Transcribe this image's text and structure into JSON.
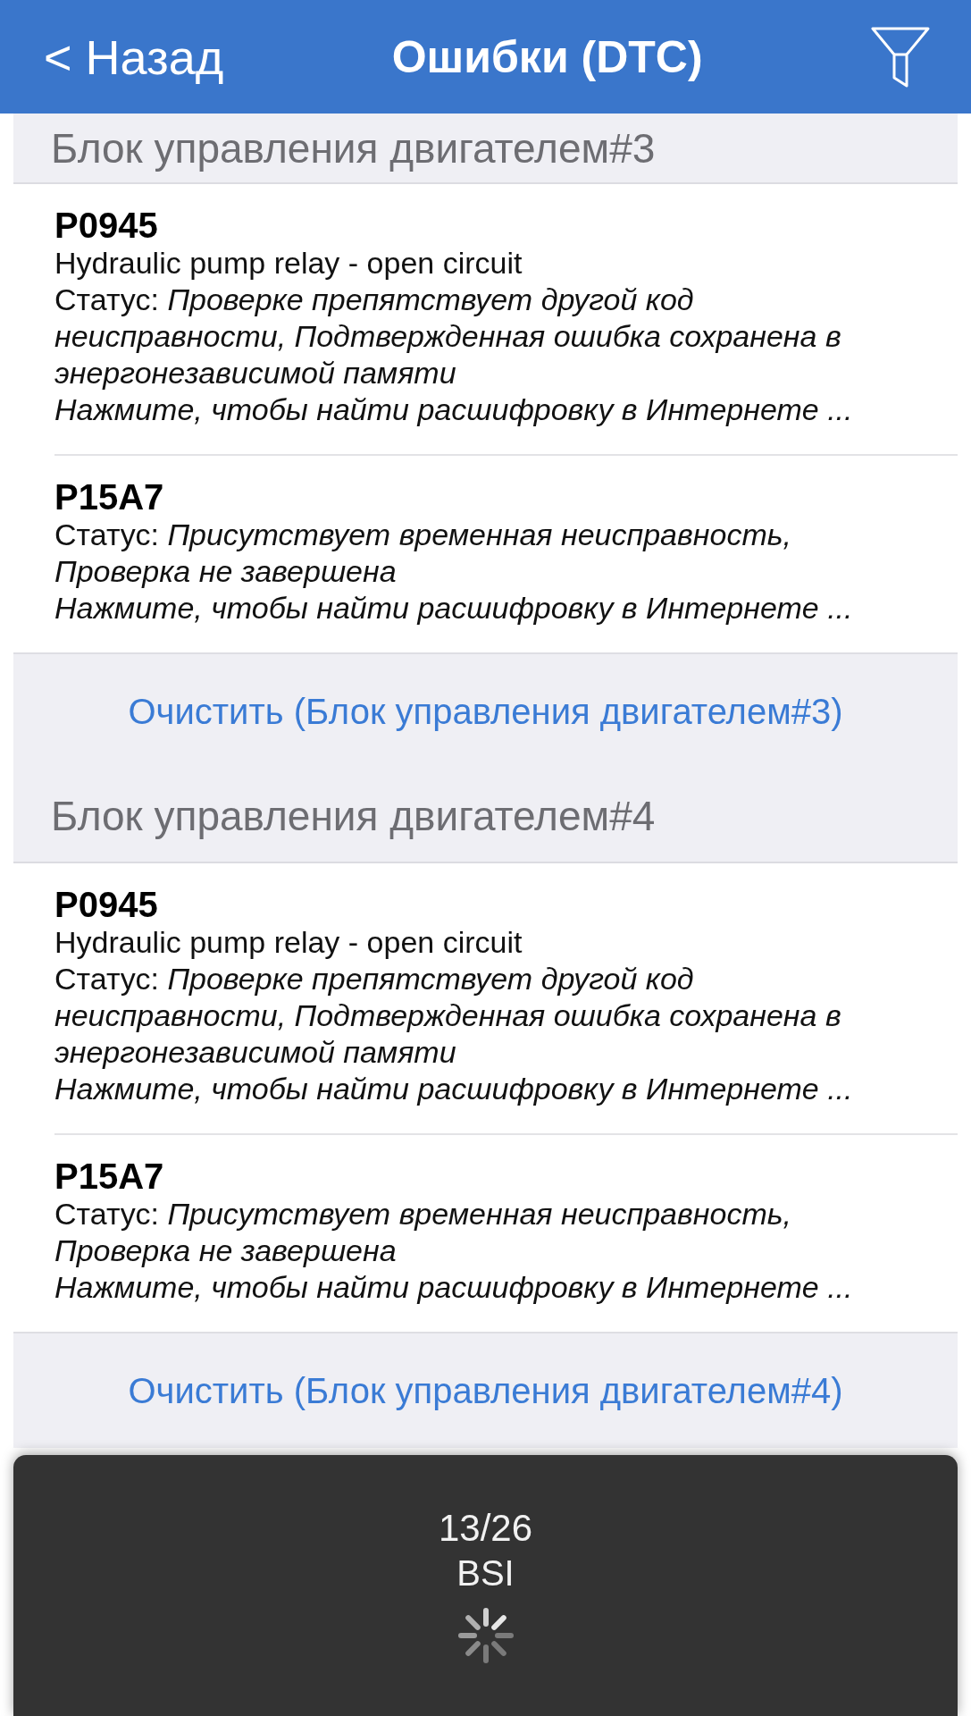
{
  "nav_bar": {
    "back_button": "< Назад",
    "title": "Ошибки (DTC)"
  },
  "sections": [
    {
      "title": "Блок управления двигателем#3",
      "errors": [
        {
          "code": "P0945",
          "description": "Hydraulic pump relay - open circuit",
          "status": "Статус: *Проверке препятствует другой код неисправности, Подтвержденная ошибка сохранена в энергонезависимой памяти*",
          "hint": "Нажмите, чтобы найти расшифровку в Интернете ..."
        },
        {
          "code": "P15A7",
          "status": "Статус: *Присутствует временная неисправность, Проверка не завершена*",
          "hint": "Нажмите, чтобы найти расшифровку в Интернете ..."
        }
      ],
      "clear_button": "Очистить (Блок управления двигателем#3)"
    },
    {
      "title": "Блок управления двигателем#4",
      "errors": [
        {
          "code": "P0945",
          "description": "Hydraulic pump relay - open circuit",
          "status": "Статус: *Проверке препятствует другой код неисправности, Подтвержденная ошибка сохранена в энергонезависимой памяти*",
          "hint": "Нажмите, чтобы найти расшифровку в Интернете ..."
        },
        {
          "code": "P15A7",
          "status": "Статус: *Присутствует временная неисправность, Проверка не завершена*",
          "hint": "Нажмите, чтобы найти расшифровку в Интернете ..."
        }
      ],
      "clear_button": "Очистить (Блок управления двигателем#4)"
    }
  ],
  "progress_overlay": {
    "counter": "13/26",
    "module": "BSI"
  }
}
